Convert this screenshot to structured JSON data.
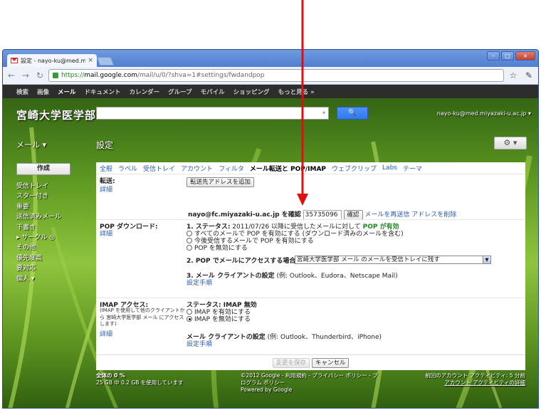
{
  "browser": {
    "tab_title": "設定 - nayo-ku@med.miyaz",
    "tab_close": "×",
    "url_https": "https://",
    "url_host": "mail.google.com",
    "url_rest": "/mail/u/0/?shva=1#settings/fwdandpop",
    "win_min": "–",
    "win_max": "□",
    "win_close": "×"
  },
  "gbar": {
    "items": [
      "検索",
      "画像",
      "メール",
      "ドキュメント",
      "カレンダー",
      "グループ",
      "モバイル",
      "ショッピング",
      "もっと見る »"
    ]
  },
  "header": {
    "logo": "宮崎大学医学部",
    "account": "nayo-ku@med.miyazaki-u.ac.jp ▾",
    "mail_label": "メール ▾",
    "settings_title": "設定",
    "gear": "⚙ ▾"
  },
  "leftnav": {
    "compose": "作成",
    "items": [
      "受信トレイ",
      "スター付き",
      "重要",
      "送信済みメール",
      "下書き",
      "▸ サークル ◎",
      "その他",
      "優先度高",
      "要対応",
      "個人 ▾"
    ]
  },
  "settings_tabs": [
    "全般",
    "ラベル",
    "受信トレイ",
    "アカウント",
    "フィルタ",
    "メール転送と POP/IMAP",
    "ウェブクリップ",
    "Labs",
    "テーマ"
  ],
  "forwarding": {
    "title": "転送:",
    "detail": "詳細",
    "add_button": "転送先アドレスを追加",
    "verify_label": "nayo@fc.miyazaki-u.ac.jp を確認",
    "code_value": "35735096",
    "confirm_button": "確認",
    "resend_link": "メールを再送信",
    "delete_link": "アドレスを削除"
  },
  "pop": {
    "title": "POP ダウンロード:",
    "detail": "詳細",
    "status_prefix": "1. ステータス:",
    "status_text": "2011/07/26 以降に受信したメールに対して",
    "status_value": "POP が有効",
    "opt1": "すべてのメールで POP を有効にする (ダウンロード済みのメールを含む)",
    "opt2": "今後受信するメールで POP を有効にする",
    "opt3": "POP を無効にする",
    "access_label": "2. POP でメールにアクセスする場合",
    "access_select": "宮崎大学医学部 メール のメールを受信トレイに残す",
    "client_label": "3. メール クライアントの設定",
    "client_example": "(例: Outlook、Eudora、Netscape Mail)",
    "client_link": "設定手順"
  },
  "imap": {
    "title": "IMAP アクセス:",
    "note": "(IMAP を使用して他のクライアントから 宮崎大学医学部 メール にアクセスします)",
    "detail": "詳細",
    "status": "ステータス: IMAP 無効",
    "opt1": "IMAP を有効にする",
    "opt2": "IMAP を無効にする",
    "client_label": "メール クライアントの設定",
    "client_example": "(例: Outlook、Thunderbird、iPhone)",
    "client_link": "設定手順"
  },
  "actions": {
    "save": "変更を保存",
    "cancel": "キャンセル"
  },
  "footer": {
    "usage_title": "全体の 0 %",
    "usage_detail": "25 GB 中 0.2 GB を使用しています",
    "copyright": "©2012 Google - 利用規約 - プライバシー ポリシー - プログラム ポリシー",
    "powered": "Powered by Google",
    "activity": "前回のアカウント アクティビティ: 5 分前",
    "activity_link": "アカウント アクティビティの詳細"
  },
  "colors": {
    "annotation": "#dd1111",
    "link": "#2a5db0",
    "pop_enabled": "#1a8a1a"
  }
}
